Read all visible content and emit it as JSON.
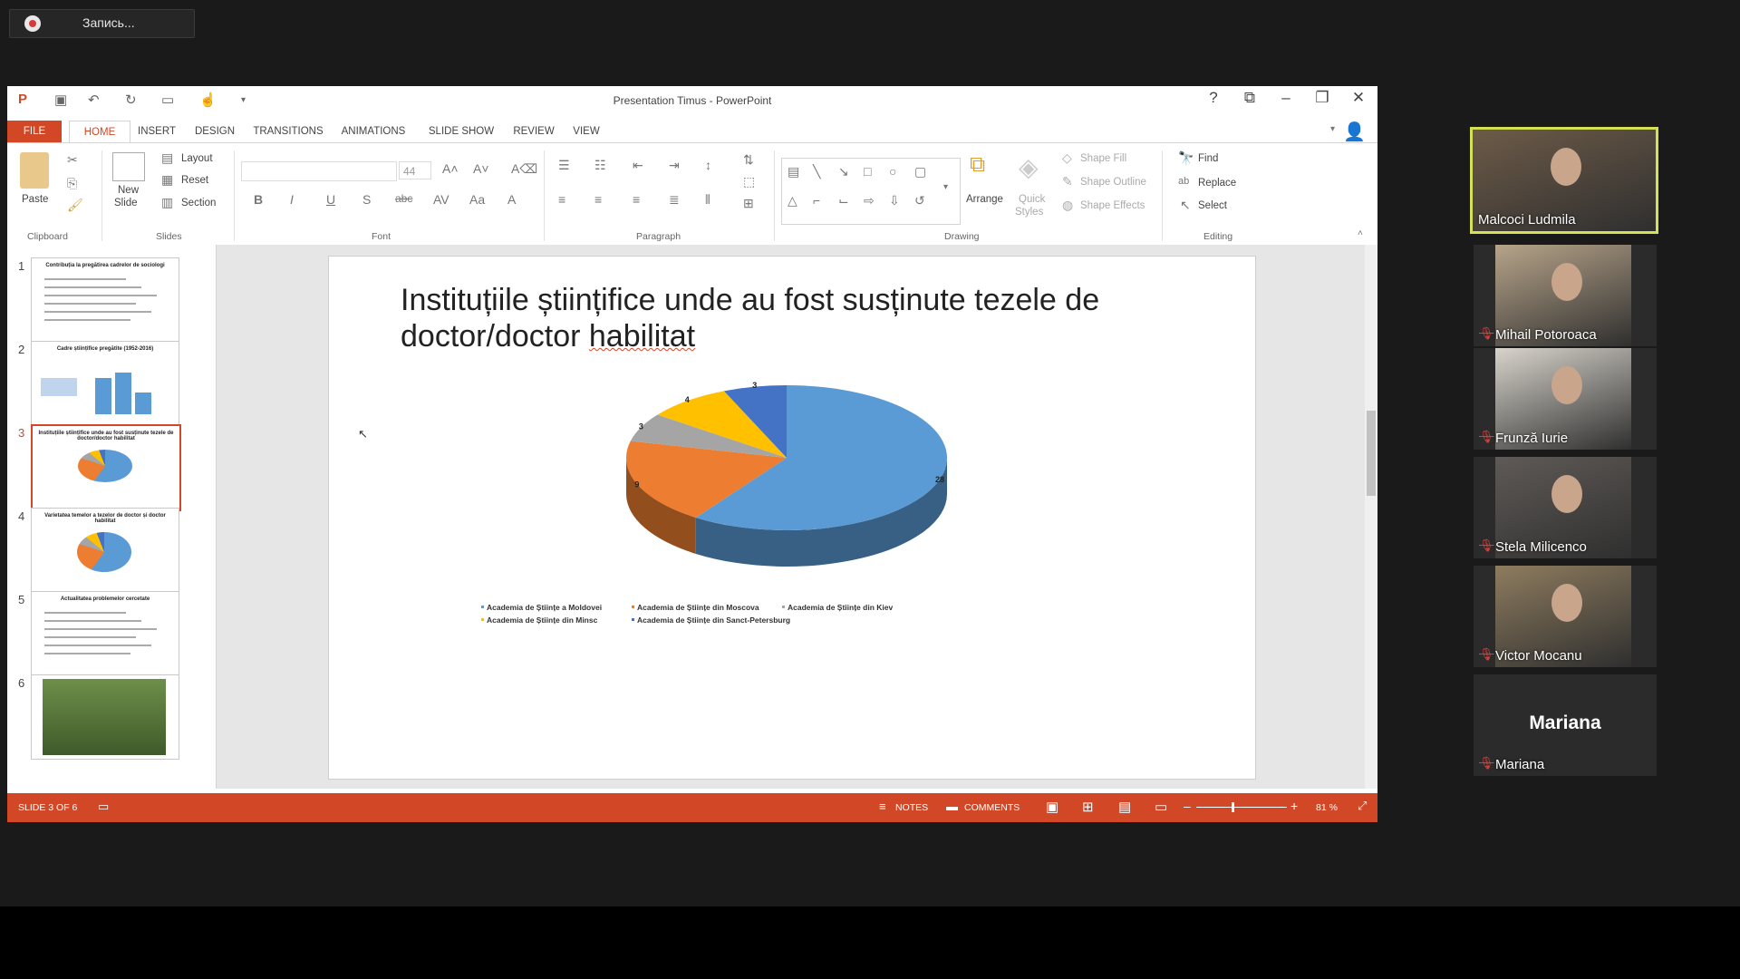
{
  "recording": {
    "label": "Запись..."
  },
  "window": {
    "title": "Presentation Timus - PowerPoint"
  },
  "tabs": [
    "FILE",
    "HOME",
    "INSERT",
    "DESIGN",
    "TRANSITIONS",
    "ANIMATIONS",
    "SLIDE SHOW",
    "REVIEW",
    "VIEW"
  ],
  "ribbon": {
    "clipboard": {
      "paste": "Paste",
      "group": "Clipboard"
    },
    "slides": {
      "new_slide_1": "New",
      "new_slide_2": "Slide",
      "layout": "Layout",
      "reset": "Reset",
      "section": "Section",
      "group": "Slides"
    },
    "font": {
      "size": "44",
      "group": "Font"
    },
    "paragraph": {
      "group": "Paragraph"
    },
    "drawing": {
      "arrange": "Arrange",
      "quick_styles_1": "Quick",
      "quick_styles_2": "Styles",
      "shape_fill": "Shape Fill",
      "shape_outline": "Shape Outline",
      "shape_effects": "Shape Effects",
      "group": "Drawing"
    },
    "editing": {
      "find": "Find",
      "replace": "Replace",
      "select": "Select",
      "group": "Editing"
    }
  },
  "thumbnails": [
    {
      "num": "1",
      "title": "Contribuția la pregătirea cadrelor de sociologi"
    },
    {
      "num": "2",
      "title": "Cadre științifice pregătite (1952-2016)"
    },
    {
      "num": "3",
      "title": "Instituțiile științifice unde au fost susținute tezele de doctor/doctor habilitat"
    },
    {
      "num": "4",
      "title": "Varietatea temelor a tezelor de doctor și doctor habilitat"
    },
    {
      "num": "5",
      "title": "Actualitatea problemelor cercetate"
    },
    {
      "num": "6",
      "title": ""
    }
  ],
  "slide": {
    "title_part1": "Instituțiile științifice unde au fost susținute tezele de doctor/doctor ",
    "title_part2": "habilitat"
  },
  "chart_data": {
    "type": "pie",
    "title": "",
    "series": [
      {
        "name": "Academia de Științe a Moldovei",
        "value": 28,
        "color": "#5b9bd5"
      },
      {
        "name": "Academia de Științe din Moscova",
        "value": 9,
        "color": "#ed7d31"
      },
      {
        "name": "Academia de Științe din Kiev",
        "value": 3,
        "color": "#a5a5a5"
      },
      {
        "name": "Academia de Științe din Minsc",
        "value": 4,
        "color": "#ffc000"
      },
      {
        "name": "Academia de Științe din Sanct-Petersburg",
        "value": 3,
        "color": "#4472c4"
      }
    ],
    "legend_position": "bottom",
    "style": "3d"
  },
  "status": {
    "slide": "SLIDE 3 OF 6",
    "notes": "NOTES",
    "comments": "COMMENTS",
    "zoom": "81 %"
  },
  "participants": [
    {
      "name": "Malcoci Ludmila",
      "muted": false,
      "active": true
    },
    {
      "name": "Mihail Potoroaca",
      "muted": true,
      "active": false
    },
    {
      "name": "Frunză Iurie",
      "muted": true,
      "active": false
    },
    {
      "name": "Stela Milicenco",
      "muted": true,
      "active": false
    },
    {
      "name": "Victor  Mocanu",
      "muted": true,
      "active": false
    },
    {
      "name": "Mariana",
      "muted": true,
      "active": false,
      "avatar_text": "Mariana"
    }
  ],
  "colors": {
    "accent": "#d24726",
    "active_speaker": "#d4e157"
  }
}
